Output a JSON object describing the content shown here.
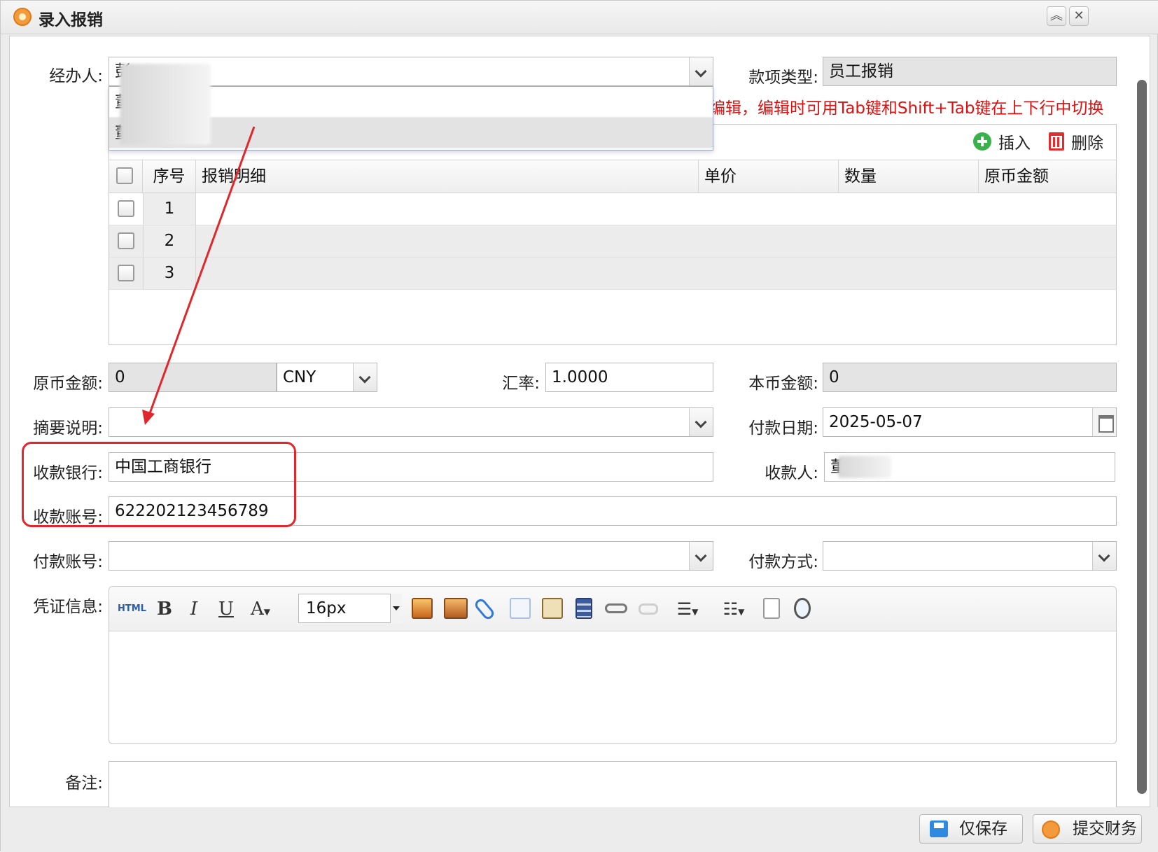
{
  "window": {
    "title": "录入报销"
  },
  "form": {
    "handler_label": "经办人:",
    "handler_value": "彭",
    "handler_options": [
      "董",
      "董"
    ],
    "type_label": "款项类型:",
    "type_value": "员工报销",
    "hint": "编辑，编辑时可用Tab键和Shift+Tab键在上下行中切换",
    "amount_label": "原币金额:",
    "amount_value": "0",
    "currency": "CNY",
    "rate_label": "汇率:",
    "rate_value": "1.0000",
    "local_label": "本币金额:",
    "local_value": "0",
    "summary_label": "摘要说明:",
    "summary_value": "",
    "paydate_label": "付款日期:",
    "paydate_value": "2025-05-07",
    "bank_label": "收款银行:",
    "bank_value": "中国工商银行",
    "payee_label": "收款人:",
    "payee_value": "董",
    "account_label": "收款账号:",
    "account_value": "622202123456789",
    "payaccount_label": "付款账号:",
    "payaccount_value": "",
    "paymethod_label": "付款方式:",
    "paymethod_value": "",
    "voucher_label": "凭证信息:",
    "remark_label": "备注:"
  },
  "grid": {
    "insert_label": "插入",
    "delete_label": "删除",
    "columns": [
      "序号",
      "报销明细",
      "单价",
      "数量",
      "原币金额"
    ],
    "rows": [
      "1",
      "2",
      "3"
    ]
  },
  "editor": {
    "html_label": "HTML",
    "bold": "B",
    "italic": "I",
    "underline": "U",
    "font_color": "A",
    "font_size": "16px"
  },
  "footer": {
    "save_label": "仅保存",
    "submit_label": "提交财务"
  },
  "colors": {
    "accent": "#e0272b",
    "hint": "#e01010"
  }
}
